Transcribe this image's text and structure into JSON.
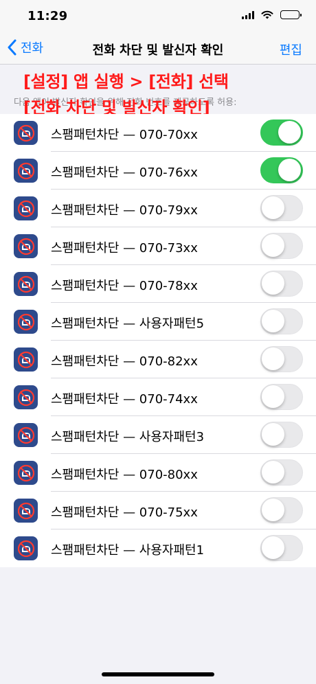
{
  "status_bar": {
    "time": "11:29",
    "icons": [
      "signal-icon",
      "wifi-icon",
      "battery-icon"
    ]
  },
  "nav": {
    "back_label": "전화",
    "title": "전화 차단 및 발신자 확인",
    "edit_label": "편집"
  },
  "section": {
    "header": "다음 앱이 발신자 확인을 위해 전화 번호를 제공하도록 허용:"
  },
  "annotation": {
    "line1": "[설정] 앱 실행 > [전화] 선택",
    "line2": "[전화 차단 및 발신자 확인]",
    "color": "#ff1a1a"
  },
  "apps": [
    {
      "label": "스팸패턴차단 — 070-70xx",
      "enabled": true
    },
    {
      "label": "스팸패턴차단 — 070-76xx",
      "enabled": true
    },
    {
      "label": "스팸패턴차단 — 070-79xx",
      "enabled": false
    },
    {
      "label": "스팸패턴차단 — 070-73xx",
      "enabled": false
    },
    {
      "label": "스팸패턴차단 — 070-78xx",
      "enabled": false
    },
    {
      "label": "스팸패턴차단 — 사용자패턴5",
      "enabled": false
    },
    {
      "label": "스팸패턴차단 — 070-82xx",
      "enabled": false
    },
    {
      "label": "스팸패턴차단 — 070-74xx",
      "enabled": false
    },
    {
      "label": "스팸패턴차단 — 사용자패턴3",
      "enabled": false
    },
    {
      "label": "스팸패턴차단 — 070-80xx",
      "enabled": false
    },
    {
      "label": "스팸패턴차단 — 070-75xx",
      "enabled": false
    },
    {
      "label": "스팸패턴차단 — 사용자패턴1",
      "enabled": false
    }
  ],
  "colors": {
    "accent": "#0a7aff",
    "toggle_on": "#34c759",
    "app_icon_bg": "#2e4a8c"
  }
}
